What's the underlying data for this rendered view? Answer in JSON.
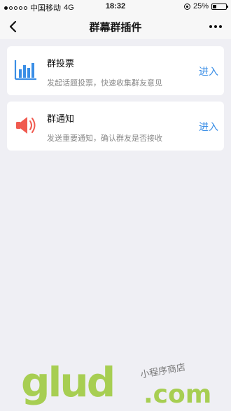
{
  "status_bar": {
    "carrier": "中国移动",
    "network": "4G",
    "time": "18:32",
    "battery": "25%",
    "battery_level": 0.25
  },
  "navbar": {
    "title": "群幕群插件"
  },
  "cards": [
    {
      "title": "群投票",
      "description": "发起话题投票，快速收集群友意见",
      "action": "进入",
      "icon": "bar-chart-icon",
      "icon_color": "#3a8ee6"
    },
    {
      "title": "群通知",
      "description": "发送重要通知，确认群友是否接收",
      "action": "进入",
      "icon": "speaker-icon",
      "icon_color": "#f05a4f"
    }
  ],
  "watermark": {
    "logo": "glud",
    "subtitle": "小程序商店",
    "domain": ".com",
    "color": "#a7ce52"
  },
  "colors": {
    "accent": "#3a8ee6",
    "background": "#efeff4"
  }
}
